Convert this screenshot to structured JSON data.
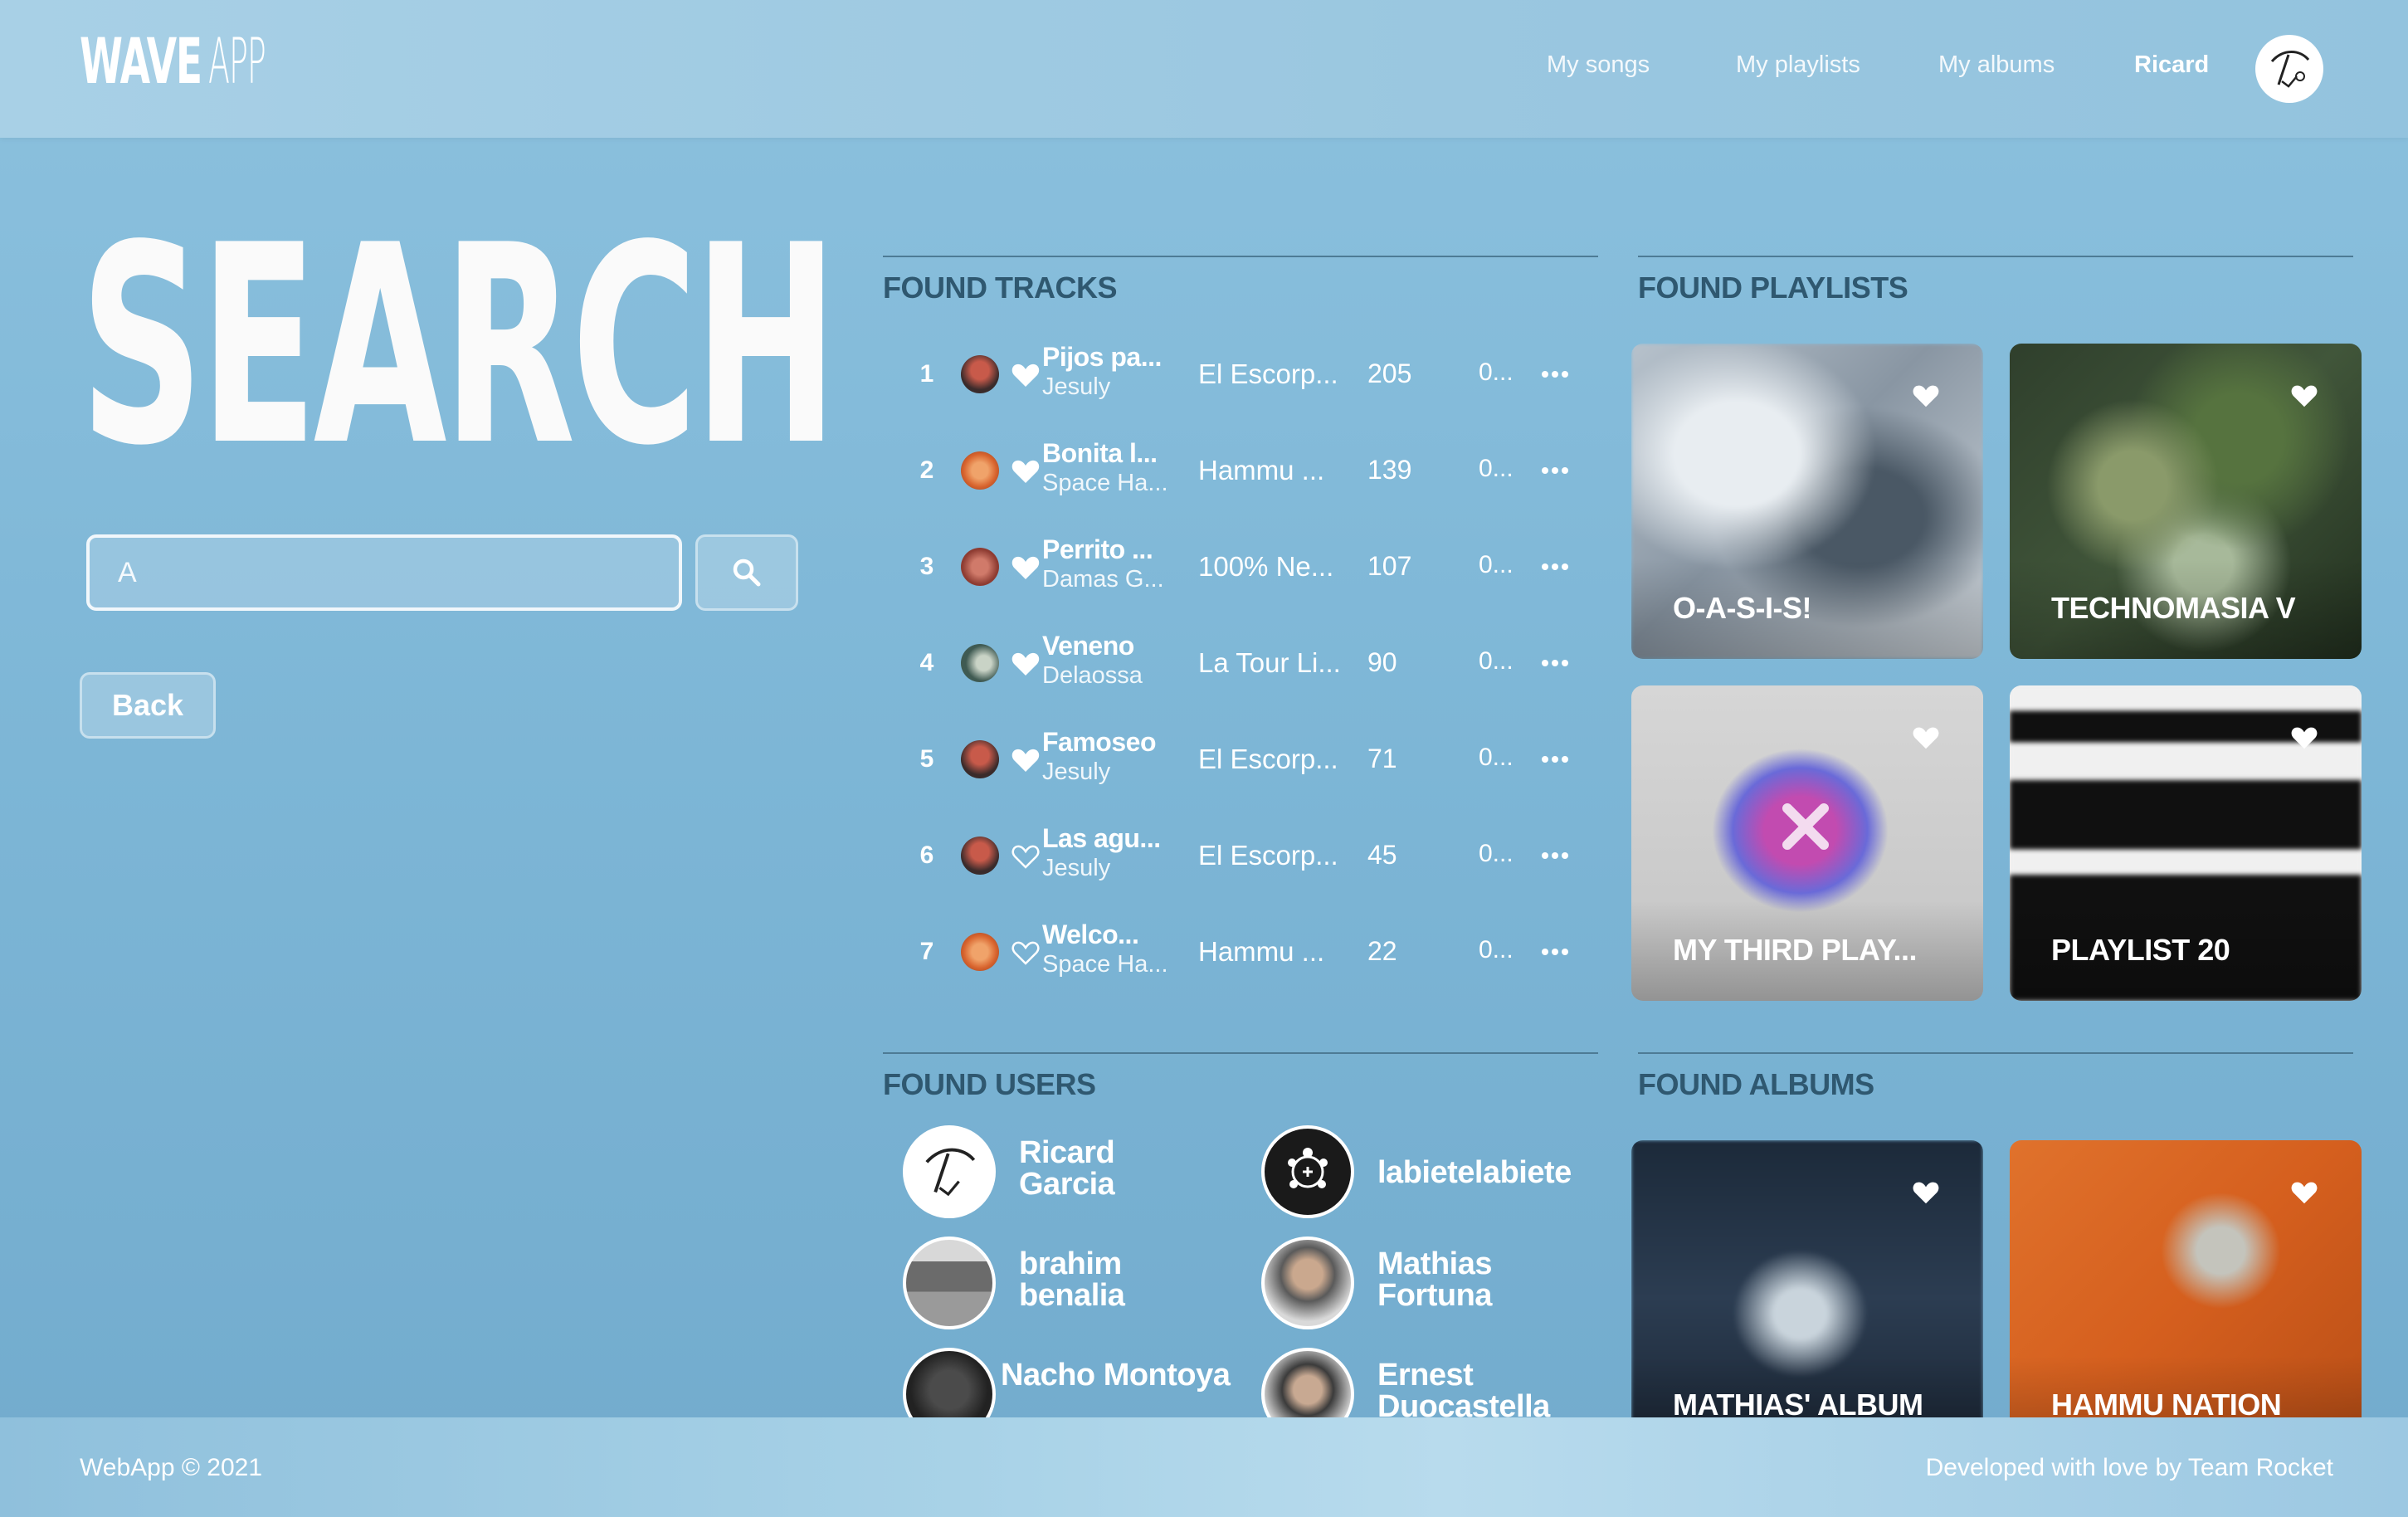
{
  "header": {
    "logo_bold": "WAVE",
    "logo_light": "APP",
    "nav": [
      "My songs",
      "My playlists",
      "My albums"
    ],
    "user_name": "Ricard"
  },
  "search": {
    "title": "SEARCH",
    "query": "A",
    "back_label": "Back"
  },
  "tracks": {
    "heading": "FOUND TRACKS",
    "items": [
      {
        "num": "1",
        "title": "Pijos pa...",
        "artist": "Jesuly",
        "album": "El Escorp...",
        "plays": "205",
        "duration": "0...",
        "liked": true
      },
      {
        "num": "2",
        "title": "Bonita l...",
        "artist": "Space Ha...",
        "album": "Hammu ...",
        "plays": "139",
        "duration": "0...",
        "liked": true
      },
      {
        "num": "3",
        "title": "Perrito ...",
        "artist": "Damas G...",
        "album": "100% Ne...",
        "plays": "107",
        "duration": "0...",
        "liked": true
      },
      {
        "num": "4",
        "title": "Veneno",
        "artist": "Delaossa",
        "album": "La Tour Li...",
        "plays": "90",
        "duration": "0...",
        "liked": true
      },
      {
        "num": "5",
        "title": "Famoseo",
        "artist": "Jesuly",
        "album": "El Escorp...",
        "plays": "71",
        "duration": "0...",
        "liked": true
      },
      {
        "num": "6",
        "title": "Las agu...",
        "artist": "Jesuly",
        "album": "El Escorp...",
        "plays": "45",
        "duration": "0...",
        "liked": false
      },
      {
        "num": "7",
        "title": "Welco...",
        "artist": "Space Ha...",
        "album": "Hammu ...",
        "plays": "22",
        "duration": "0...",
        "liked": false
      }
    ]
  },
  "playlists": {
    "heading": "FOUND PLAYLISTS",
    "items": [
      {
        "title": "O-A-S-I-S!"
      },
      {
        "title": "TECHNOMASIA V"
      },
      {
        "title": "MY THIRD PLAY..."
      },
      {
        "title": "PLAYLIST 20"
      }
    ]
  },
  "users": {
    "heading": "FOUND USERS",
    "items": [
      {
        "name": "Ricard Garcia"
      },
      {
        "name": "labietelabiete"
      },
      {
        "name": "brahim benalia"
      },
      {
        "name": "Mathias Fortuna"
      },
      {
        "name": "Nacho Montoya"
      },
      {
        "name": "Ernest Duocastella"
      }
    ]
  },
  "albums": {
    "heading": "FOUND ALBUMS",
    "items": [
      {
        "title": "MATHIAS' ALBUM"
      },
      {
        "title": "HAMMU NATION"
      }
    ]
  },
  "footer": {
    "left": "WebApp © 2021",
    "right": "Developed with love by Team Rocket"
  }
}
